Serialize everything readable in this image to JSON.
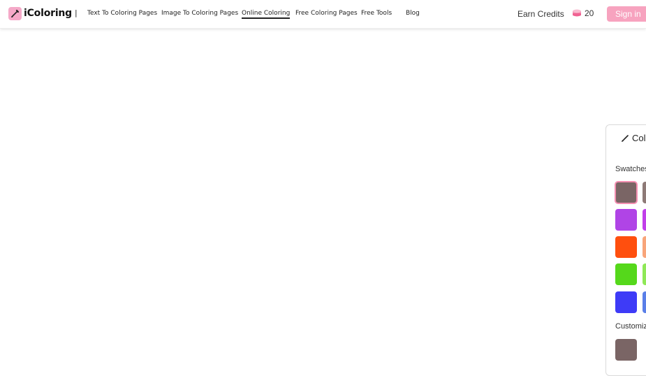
{
  "header": {
    "logo_text": "iColoring",
    "separator": "|",
    "nav": [
      {
        "label": "Text To Coloring Pages",
        "active": false
      },
      {
        "label": "Image To Coloring Pages",
        "active": false
      },
      {
        "label": "Online Coloring",
        "active": true
      },
      {
        "label": "Free Coloring Pages",
        "active": false
      },
      {
        "label": "Free Tools",
        "active": false
      },
      {
        "label": "Blog",
        "active": false
      }
    ],
    "earn_credits": "Earn Credits",
    "credits_count": "20",
    "sign_in": "Sign in"
  },
  "panel": {
    "title": "Colo",
    "swatches_label": "Swatches",
    "customize_label": "Customiz",
    "swatches": [
      [
        "#7a6565",
        "#8e7a77"
      ],
      [
        "#b044e6",
        "#c13fe9"
      ],
      [
        "#ff4f0e",
        "#f8a57a"
      ],
      [
        "#55d81b",
        "#8fe857"
      ],
      [
        "#3e3bf7",
        "#5a7fe8"
      ]
    ],
    "custom_color": "#7a6565"
  },
  "colors": {
    "accent_pink": "#f7a3bf"
  }
}
